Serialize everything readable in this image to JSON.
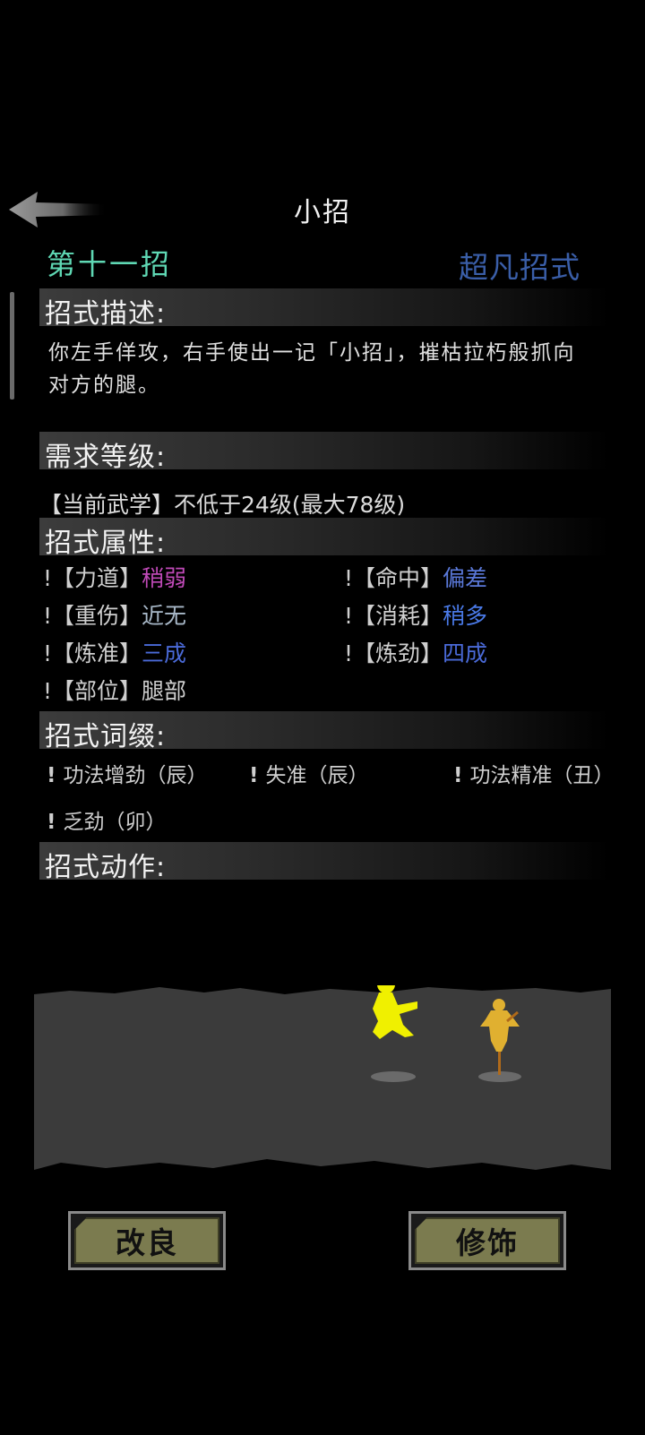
{
  "header": {
    "title": "小招"
  },
  "move": {
    "index": "第十一招",
    "grade": "超凡招式"
  },
  "sections": {
    "description": "招式描述:",
    "requirement": "需求等级:",
    "attributes": "招式属性:",
    "affixes": "招式词缀:",
    "action": "招式动作:"
  },
  "description_text": "你左手佯攻，右手使出一记「小招」，摧枯拉朽般抓向对方的腿。",
  "requirement_text": "【当前武学】不低于24级(最大78级)",
  "attributes": [
    {
      "label": "!【力道】",
      "value": "稍弱",
      "color": "#c04ab8"
    },
    {
      "label": "!【命中】",
      "value": "偏差",
      "color": "#5a78d8"
    },
    {
      "label": "!【重伤】",
      "value": "近无",
      "color": "#a8b8c8"
    },
    {
      "label": "!【消耗】",
      "value": "稍多",
      "color": "#4a7ae8"
    },
    {
      "label": "!【炼准】",
      "value": "三成",
      "color": "#4a6ad8"
    },
    {
      "label": "!【炼劲】",
      "value": "四成",
      "color": "#4a6ad8"
    },
    {
      "label": "!【部位】",
      "value": "腿部",
      "color": "#cfcfcf"
    }
  ],
  "affixes": [
    {
      "bang": "!",
      "text": "功法增劲（辰）"
    },
    {
      "bang": "!",
      "text": "失准（辰）"
    },
    {
      "bang": "!",
      "text": "功法精准（丑）"
    },
    {
      "bang": "!",
      "text": "乏劲（卯）"
    }
  ],
  "buttons": {
    "improve": "改良",
    "decorate": "修饰"
  },
  "colors": {
    "accent_teal": "#5fd8b4",
    "grade_blue": "#3a5ea8",
    "button_olive": "#7b7b4f",
    "figure_yellow": "#f0f000"
  }
}
